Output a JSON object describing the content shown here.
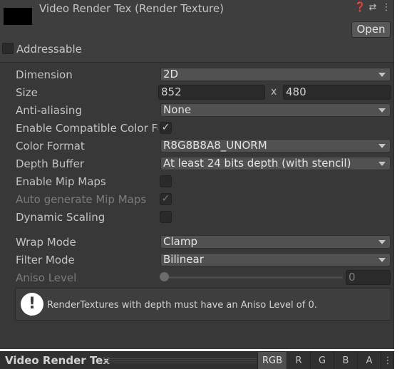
{
  "header": {
    "title": "Video Render Tex (Render Texture)",
    "open_label": "Open",
    "help_icon": "help-icon",
    "settings_icon": "preset-icon",
    "menu_icon": "kebab-icon"
  },
  "addressable": {
    "label": "Addressable",
    "checked": false
  },
  "fields": {
    "dimension": {
      "label": "Dimension",
      "value": "2D"
    },
    "size": {
      "label": "Size",
      "width": "852",
      "x": "x",
      "height": "480"
    },
    "anti_aliasing": {
      "label": "Anti-aliasing",
      "value": "None"
    },
    "compatible_color": {
      "label": "Enable Compatible Color Fo",
      "check": "✓"
    },
    "color_format": {
      "label": "Color Format",
      "value": "R8G8B8A8_UNORM"
    },
    "depth_buffer": {
      "label": "Depth Buffer",
      "value": "At least 24 bits depth (with stencil)"
    },
    "mip_maps": {
      "label": "Enable Mip Maps",
      "check": ""
    },
    "auto_mip": {
      "label": "Auto generate Mip Maps",
      "check": "✓"
    },
    "dynamic_scaling": {
      "label": "Dynamic Scaling",
      "check": ""
    },
    "wrap_mode": {
      "label": "Wrap Mode",
      "value": "Clamp"
    },
    "filter_mode": {
      "label": "Filter Mode",
      "value": "Bilinear"
    },
    "aniso": {
      "label": "Aniso Level",
      "value": "0",
      "level": 0
    }
  },
  "help_box": {
    "icon": "!",
    "text": "RenderTextures with depth must have an Aniso Level of 0."
  },
  "bottombar": {
    "title": "Video Render Tex",
    "channels": [
      "RGB",
      "R",
      "G",
      "B",
      "A"
    ],
    "active_channel": "RGB",
    "menu": "⋮"
  },
  "colors": {
    "panel": "#383838",
    "field": "#515151",
    "text": "#c4c4c4"
  }
}
